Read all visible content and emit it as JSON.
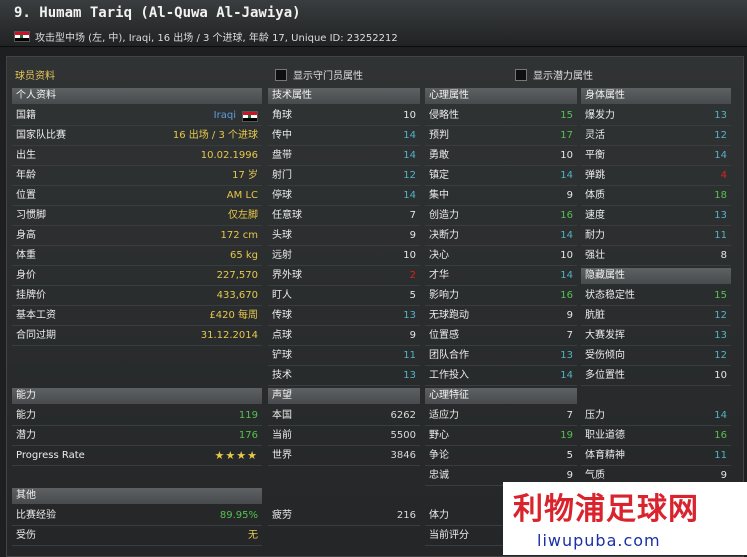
{
  "header": {
    "title": "9. Humam Tariq (Al-Quwa Al-Jawiya)",
    "subtitle": "攻击型中场 (左, 中), Iraqi, 16 出场 / 3 个进球, 年龄 17, Unique ID: 23252212"
  },
  "panel": {
    "title": "球员资料",
    "show_gk_label": "显示守门员属性",
    "show_potential_label": "显示潜力属性"
  },
  "personal": {
    "heading": "个人资料",
    "rows": [
      {
        "label": "国籍",
        "value": "Iraqi"
      },
      {
        "label": "国家队比赛",
        "value": "16 出场 / 3 个进球"
      },
      {
        "label": "出生",
        "value": "10.02.1996"
      },
      {
        "label": "年龄",
        "value": "17 岁"
      },
      {
        "label": "位置",
        "value": "AM LC"
      },
      {
        "label": "习惯脚",
        "value": "仅左脚"
      },
      {
        "label": "身高",
        "value": "172 cm"
      },
      {
        "label": "体重",
        "value": "65 kg"
      },
      {
        "label": "身价",
        "value": "227,570"
      },
      {
        "label": "挂牌价",
        "value": "433,670"
      },
      {
        "label": "基本工资",
        "value": "£420 每周"
      },
      {
        "label": "合同过期",
        "value": "31.12.2014"
      }
    ]
  },
  "ability": {
    "heading": "能力",
    "rows": [
      {
        "label": "能力",
        "value": "119"
      },
      {
        "label": "潜力",
        "value": "176"
      },
      {
        "label": "Progress Rate",
        "value": "★★★★",
        "stars": 4
      }
    ]
  },
  "other": {
    "heading": "其他",
    "rows": [
      {
        "label": "比赛经验",
        "value": "89.95%"
      },
      {
        "label": "受伤",
        "value": "无"
      }
    ]
  },
  "technical": {
    "heading": "技术属性",
    "rows": [
      {
        "label": "角球",
        "value": "10"
      },
      {
        "label": "传中",
        "value": "14"
      },
      {
        "label": "盘带",
        "value": "14"
      },
      {
        "label": "射门",
        "value": "12"
      },
      {
        "label": "停球",
        "value": "14"
      },
      {
        "label": "任意球",
        "value": "7"
      },
      {
        "label": "头球",
        "value": "9"
      },
      {
        "label": "远射",
        "value": "10"
      },
      {
        "label": "界外球",
        "value": "2"
      },
      {
        "label": "盯人",
        "value": "5"
      },
      {
        "label": "传球",
        "value": "13"
      },
      {
        "label": "点球",
        "value": "9"
      },
      {
        "label": "铲球",
        "value": "11"
      },
      {
        "label": "技术",
        "value": "13"
      }
    ]
  },
  "reputation": {
    "heading": "声望",
    "rows": [
      {
        "label": "本国",
        "value": "6262"
      },
      {
        "label": "当前",
        "value": "5500"
      },
      {
        "label": "世界",
        "value": "3846"
      }
    ]
  },
  "misc": {
    "rows": [
      {
        "label": "疲劳",
        "value": "216"
      }
    ]
  },
  "mental": {
    "heading": "心理属性",
    "rows": [
      {
        "label": "侵略性",
        "value": "15"
      },
      {
        "label": "预判",
        "value": "17"
      },
      {
        "label": "勇敢",
        "value": "10"
      },
      {
        "label": "镇定",
        "value": "14"
      },
      {
        "label": "集中",
        "value": "9"
      },
      {
        "label": "创造力",
        "value": "16"
      },
      {
        "label": "决断力",
        "value": "14"
      },
      {
        "label": "决心",
        "value": "10"
      },
      {
        "label": "才华",
        "value": "14"
      },
      {
        "label": "影响力",
        "value": "16"
      },
      {
        "label": "无球跑动",
        "value": "9"
      },
      {
        "label": "位置感",
        "value": "7"
      },
      {
        "label": "团队合作",
        "value": "13"
      },
      {
        "label": "工作投入",
        "value": "14"
      }
    ]
  },
  "mental_traits": {
    "heading": "心理特征",
    "rows": [
      {
        "label": "适应力",
        "value": "7"
      },
      {
        "label": "野心",
        "value": "19"
      },
      {
        "label": "争论",
        "value": "5"
      },
      {
        "label": "忠诚",
        "value": "9"
      }
    ]
  },
  "bottom_mid": {
    "rows": [
      {
        "label": "体力",
        "value": ""
      },
      {
        "label": "当前评分",
        "value": ""
      }
    ]
  },
  "physical": {
    "heading": "身体属性",
    "rows": [
      {
        "label": "爆发力",
        "value": "13"
      },
      {
        "label": "灵活",
        "value": "12"
      },
      {
        "label": "平衡",
        "value": "14"
      },
      {
        "label": "弹跳",
        "value": "4"
      },
      {
        "label": "体质",
        "value": "18"
      },
      {
        "label": "速度",
        "value": "13"
      },
      {
        "label": "耐力",
        "value": "11"
      },
      {
        "label": "强壮",
        "value": "8"
      }
    ]
  },
  "hidden": {
    "heading": "隐藏属性",
    "rows": [
      {
        "label": "状态稳定性",
        "value": "15"
      },
      {
        "label": "肮脏",
        "value": "12"
      },
      {
        "label": "大赛发挥",
        "value": "13"
      },
      {
        "label": "受伤倾向",
        "value": "12"
      },
      {
        "label": "多位置性",
        "value": "10"
      }
    ]
  },
  "traits_right": {
    "rows": [
      {
        "label": "压力",
        "value": "14"
      },
      {
        "label": "职业道德",
        "value": "16"
      },
      {
        "label": "体育精神",
        "value": "11"
      },
      {
        "label": "气质",
        "value": "9"
      }
    ]
  },
  "watermark": {
    "cn": "利物浦足球网",
    "en": "liwupuba.com"
  },
  "colors": {
    "yellow": "#e7c84b",
    "blue": "#5f9fdc",
    "green": "#55c24f",
    "red": "#e02020"
  }
}
